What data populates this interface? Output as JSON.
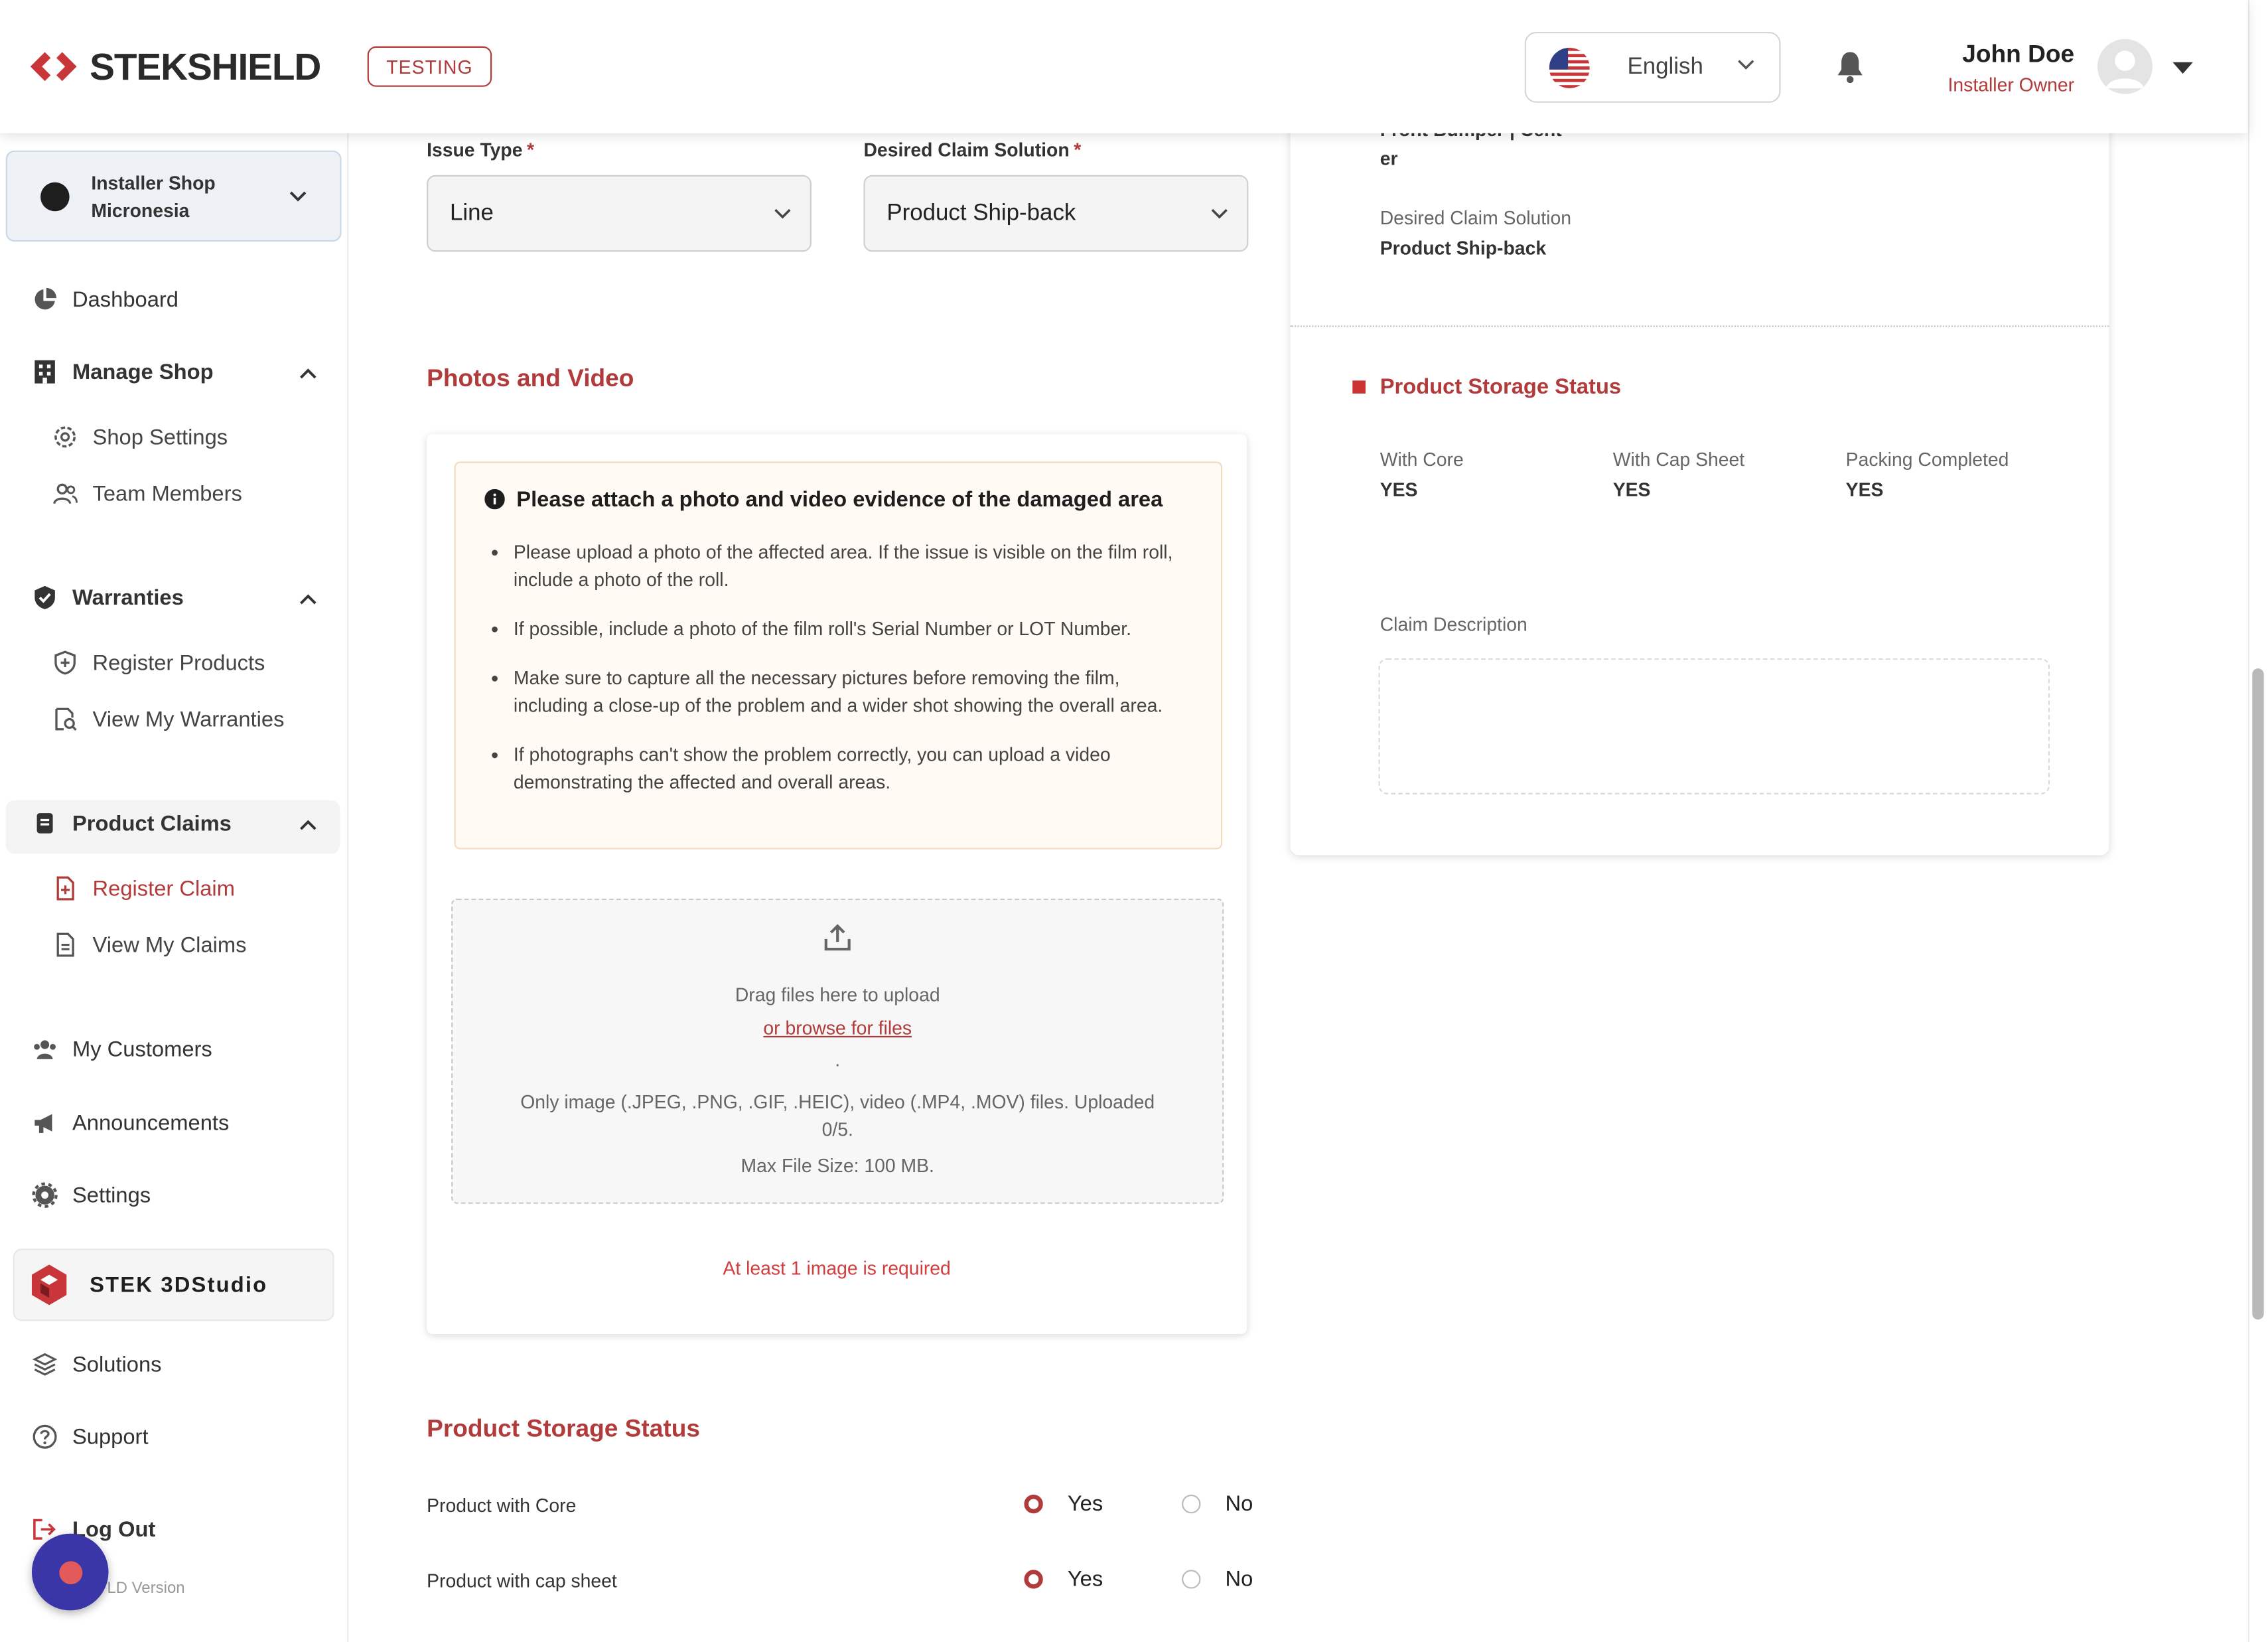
{
  "header": {
    "brand": "STEKSHIELD",
    "env_badge": "TESTING",
    "language": "English",
    "user_name": "John Doe",
    "user_role": "Installer Owner"
  },
  "sidebar": {
    "shop_name": "Installer Shop Micronesia",
    "items": {
      "dashboard": "Dashboard",
      "manage_shop": "Manage Shop",
      "shop_settings": "Shop Settings",
      "team_members": "Team Members",
      "warranties": "Warranties",
      "register_products": "Register Products",
      "view_my_warranties": "View My Warranties",
      "product_claims": "Product Claims",
      "register_claim": "Register Claim",
      "view_my_claims": "View My Claims",
      "my_customers": "My Customers",
      "announcements": "Announcements",
      "settings": "Settings",
      "studio": "STEK 3DStudio",
      "solutions": "Solutions",
      "support": "Support",
      "log_out": "Log Out"
    },
    "version_fragment": "LD Version"
  },
  "form": {
    "issue_type": {
      "label": "Issue Type",
      "required": "*",
      "value": "Line"
    },
    "desired_solution": {
      "label": "Desired Claim Solution",
      "required": "*",
      "value": "Product Ship-back"
    },
    "photos_title": "Photos and Video",
    "notice": {
      "title": "Please attach a photo and video evidence of the damaged area",
      "bullets": [
        "Please upload a photo of the affected area. If the issue is visible on the film roll, include a photo of the roll.",
        "If possible, include a photo of the film roll's Serial Number or LOT Number.",
        "Make sure to capture all the necessary pictures before removing the film, including a close-up of the problem and a wider shot showing the overall area.",
        "If photographs can't show the problem correctly, you can upload a video demonstrating the affected and overall areas."
      ]
    },
    "dropzone": {
      "drag_text": "Drag files here to upload",
      "browse_link": "or browse for files",
      "dot": ".",
      "formats": "Only image (.JPEG, .PNG, .GIF, .HEIC), video (.MP4, .MOV) files. Uploaded 0/5.",
      "max_size": "Max File Size: 100 MB."
    },
    "error": "At least 1 image is required",
    "storage_title": "Product Storage Status",
    "storage_rows": [
      {
        "label": "Product with Core",
        "yes": "Yes",
        "no": "No",
        "selected": "yes"
      },
      {
        "label": "Product with cap sheet",
        "yes": "Yes",
        "no": "No",
        "selected": "yes"
      }
    ]
  },
  "summary": {
    "truncated_value_1": "Front Bumper | Cent",
    "truncated_value_2": "er",
    "desired_solution_label": "Desired Claim Solution",
    "desired_solution_value": "Product Ship-back",
    "storage_title": "Product Storage Status",
    "with_core_label": "With Core",
    "with_core_value": "YES",
    "with_cap_label": "With Cap Sheet",
    "with_cap_value": "YES",
    "packing_label": "Packing Completed",
    "packing_value": "YES",
    "description_label": "Claim Description",
    "description_value": ""
  },
  "colors": {
    "accent": "#b13a3a",
    "fab": "#3b36a8"
  }
}
